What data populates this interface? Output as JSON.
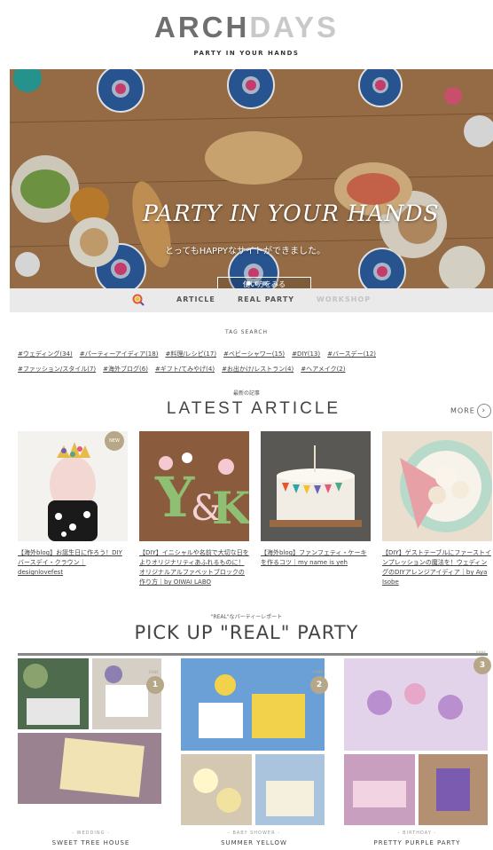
{
  "brand": {
    "logo_arch": "ARCH",
    "logo_days": "DAYS",
    "tagline": "PARTY IN YOUR HANDS"
  },
  "hero": {
    "title": "PARTY IN YOUR HANDS",
    "subtitle": "とってもHAPPYなサイトができました。",
    "button_label": "使い方をみる"
  },
  "nav": {
    "items": [
      "ARTICLE",
      "REAL PARTY",
      "WORKSHOP"
    ]
  },
  "tag_search": {
    "title": "TAG SEARCH",
    "tags": [
      "#ウェディング(34)",
      "#パーティーアイディア(18)",
      "#料理/レシピ(17)",
      "#ベビーシャワー(15)",
      "#DIY(13)",
      "#バースデー(12)",
      "#ファッション/スタイル(7)",
      "#海外ブログ(6)",
      "#ギフト/てみやげ(4)",
      "#お出かけ/レストラン(4)",
      "#ヘアメイク(2)"
    ]
  },
  "latest": {
    "small_label": "最新の記事",
    "title": "LATEST ARTICLE",
    "more_label": "MORE",
    "new_badge": "NEW",
    "articles": [
      {
        "caption": "【海外blog】お誕生日に作ろう！DIYバースデイ・クラウン｜designlovefest"
      },
      {
        "caption": "【DIY】イニシャルや名前で大切な日をよりオリジナリティあふれるものに！オリジナルアルファベットブロックの作り方｜by OIWAI LABO"
      },
      {
        "caption": "【海外blog】ファンフェティ・ケーキを作るコツ｜my name is yeh"
      },
      {
        "caption": "【DIY】ゲストテーブルにファーストインプレッションの魔法を！ウェディングのDIYアレンジアイディア｜by Aya Isobe"
      }
    ]
  },
  "pickup": {
    "small_label": "\"REAL\"なパーティーレポート",
    "title": "PICK UP \"REAL\" PARTY",
    "rank_label": "RANK",
    "parties": [
      {
        "rank": "1",
        "category": "- WEDDING -",
        "name": "SWEET TREE HOUSE"
      },
      {
        "rank": "2",
        "category": "- BABY SHOWER -",
        "name": "SUMMER YELLOW"
      },
      {
        "rank": "3",
        "category": "- BIRTHDAY -",
        "name": "PRETTY PURPLE PARTY"
      }
    ]
  }
}
